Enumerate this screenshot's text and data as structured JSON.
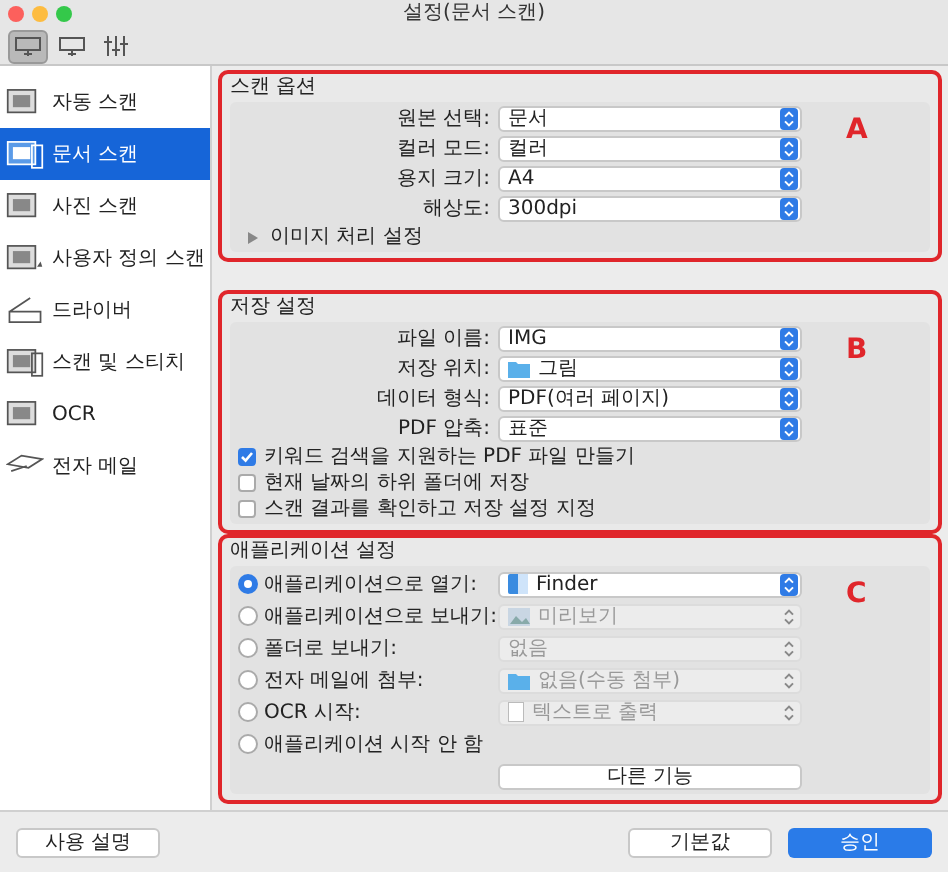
{
  "window": {
    "title": "설정(문서 스캔)"
  },
  "toolbar": {
    "tabs": [
      {
        "selected": true
      },
      {
        "selected": false
      },
      {
        "selected": false
      }
    ]
  },
  "sidebar": {
    "items": [
      {
        "label": "자동 스캔",
        "selected": false
      },
      {
        "label": "문서 스캔",
        "selected": true
      },
      {
        "label": "사진 스캔",
        "selected": false
      },
      {
        "label": "사용자 정의 스캔",
        "selected": false
      },
      {
        "label": "드라이버",
        "selected": false
      },
      {
        "label": "스캔 및 스티치",
        "selected": false
      },
      {
        "label": "OCR",
        "selected": false
      },
      {
        "label": "전자 메일",
        "selected": false
      }
    ]
  },
  "scan_options": {
    "title": "스캔 옵션",
    "marker": "A",
    "fields": [
      {
        "label": "원본 선택:",
        "value": "문서"
      },
      {
        "label": "컬러 모드:",
        "value": "컬러"
      },
      {
        "label": "용지 크기:",
        "value": "A4"
      },
      {
        "label": "해상도:",
        "value": "300dpi"
      }
    ],
    "disclosure": {
      "label": "이미지 처리 설정",
      "expanded": false
    }
  },
  "save_settings": {
    "title": "저장 설정",
    "marker": "B",
    "fields": [
      {
        "label": "파일 이름:",
        "value": "IMG"
      },
      {
        "label": "저장 위치:",
        "value": "그림"
      },
      {
        "label": "데이터 형식:",
        "value": "PDF(여러 페이지)"
      },
      {
        "label": "PDF 압축:",
        "value": "표준"
      }
    ],
    "checkboxes": [
      {
        "label": "키워드 검색을 지원하는 PDF 파일 만들기",
        "checked": true
      },
      {
        "label": "현재 날짜의 하위 폴더에 저장",
        "checked": false
      },
      {
        "label": "스캔 결과를 확인하고 저장 설정 지정",
        "checked": false
      }
    ]
  },
  "application_settings": {
    "title": "애플리케이션 설정",
    "marker": "C",
    "options": [
      {
        "label": "애플리케이션으로 열기:",
        "value": "Finder",
        "selected": true
      },
      {
        "label": "애플리케이션으로 보내기:",
        "value": "미리보기",
        "selected": false
      },
      {
        "label": "폴더로 보내기:",
        "value": "없음",
        "selected": false
      },
      {
        "label": "전자 메일에 첨부:",
        "value": "없음(수동 첨부)",
        "selected": false
      },
      {
        "label": "OCR 시작:",
        "value": "텍스트로 출력",
        "selected": false
      },
      {
        "label": "애플리케이션 시작 안 함",
        "selected": false
      }
    ],
    "button": "다른 기능"
  },
  "footer": {
    "buttons": [
      {
        "label": "사용 설명",
        "kind": "default"
      },
      {
        "label": "기본값",
        "kind": "default"
      },
      {
        "label": "승인",
        "kind": "primary"
      }
    ]
  }
}
